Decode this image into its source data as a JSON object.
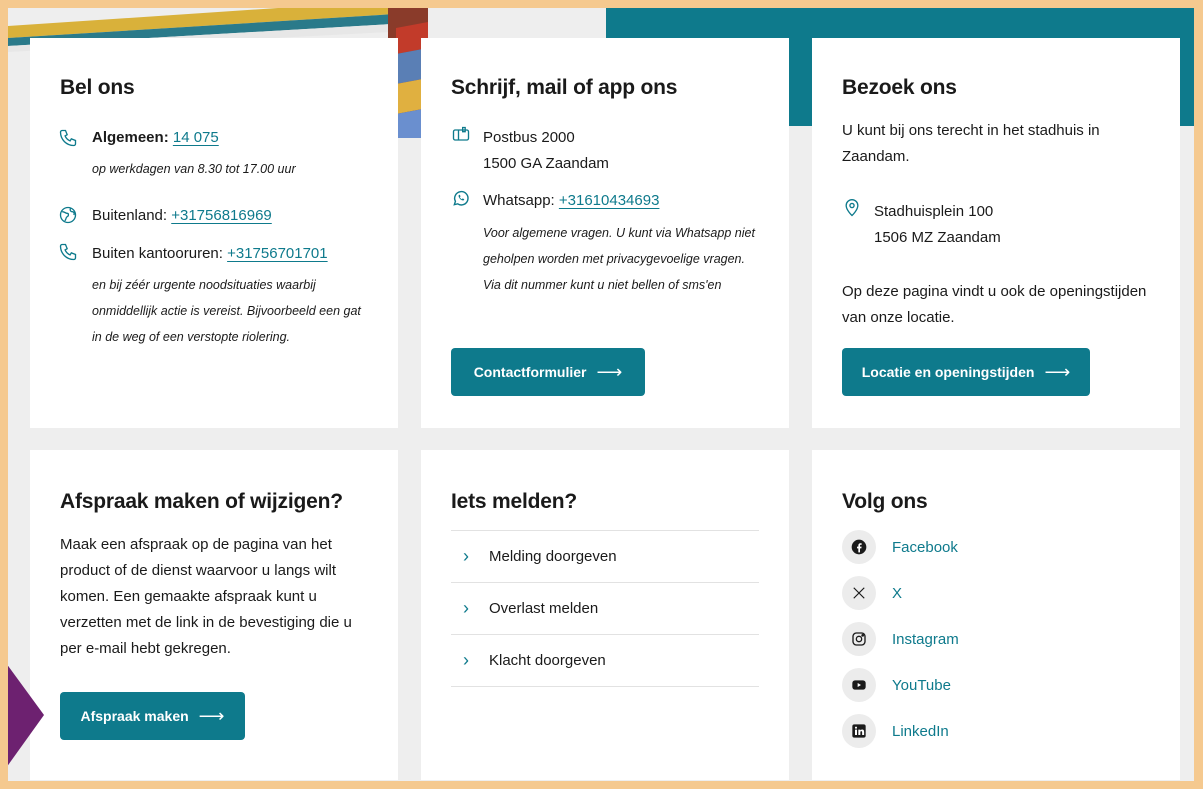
{
  "colors": {
    "accent": "#0e7a8c",
    "frame": "#f5c98f",
    "page_bg": "#eeeeee",
    "purple": "#6d2170"
  },
  "bel_ons": {
    "title": "Bel ons",
    "algemeen_label": "Algemeen:",
    "algemeen_number": "14 075",
    "algemeen_note": "op werkdagen van 8.30 tot 17.00 uur",
    "buitenland_label": "Buitenland:",
    "buitenland_number": "+31756816969",
    "kantoor_label": "Buiten kantooruren:",
    "kantoor_number": "+31756701701",
    "kantoor_note_1": "en bij zéér urgente noodsituaties waarbij",
    "kantoor_note_2": "onmiddellijk actie is vereist. Bijvoorbeeld een gat",
    "kantoor_note_3": "in de weg of een verstopte riolering."
  },
  "schrijf": {
    "title": "Schrijf, mail of app ons",
    "postbus": "Postbus 2000",
    "postcode": "1500 GA Zaandam",
    "whatsapp_label": "Whatsapp:",
    "whatsapp_number": "+31610434693",
    "whatsapp_note_1": "Voor algemene vragen. U kunt via Whatsapp niet",
    "whatsapp_note_2": "geholpen worden met privacygevoelige vragen.",
    "whatsapp_note_3": "Via dit nummer kunt u niet bellen of sms'en",
    "button": "Contactformulier"
  },
  "bezoek": {
    "title": "Bezoek ons",
    "intro_1": "U kunt bij ons terecht in het stadhuis in",
    "intro_2": "Zaandam.",
    "address_1": "Stadhuisplein 100",
    "address_2": "1506 MZ Zaandam",
    "info_1": "Op deze pagina vindt u ook de openingstijden",
    "info_2": "van onze locatie.",
    "button": "Locatie en openingstijden"
  },
  "afspraak": {
    "title": "Afspraak maken of wijzigen?",
    "body_1": "Maak een afspraak op de pagina van het",
    "body_2": "product of de dienst waarvoor u langs wilt",
    "body_3": "komen. Een gemaakte afspraak kunt u",
    "body_4": "verzetten met de link in de bevestiging die u",
    "body_5": "per e-mail hebt gekregen.",
    "button": "Afspraak maken"
  },
  "melden": {
    "title": "Iets melden?",
    "items": [
      {
        "label": "Melding doorgeven"
      },
      {
        "label": "Overlast melden"
      },
      {
        "label": "Klacht doorgeven"
      }
    ]
  },
  "volg": {
    "title": "Volg ons",
    "items": [
      {
        "label": "Facebook",
        "icon": "facebook-icon"
      },
      {
        "label": "X",
        "icon": "x-icon"
      },
      {
        "label": "Instagram",
        "icon": "instagram-icon"
      },
      {
        "label": "YouTube",
        "icon": "youtube-icon"
      },
      {
        "label": "LinkedIn",
        "icon": "linkedin-icon"
      }
    ]
  }
}
